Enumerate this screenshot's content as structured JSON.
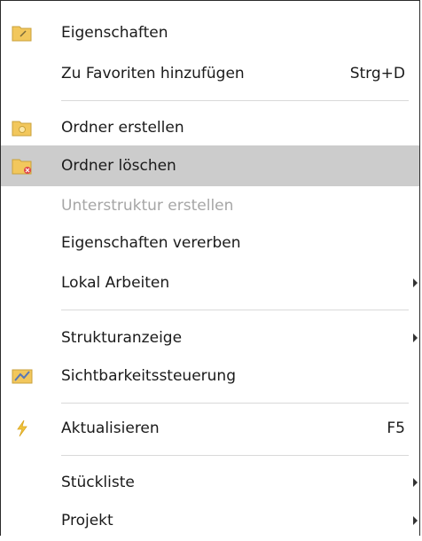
{
  "menu": {
    "items": [
      {
        "label": "Eigenschaften",
        "icon": "folder-edit-icon"
      },
      {
        "label": "Zu Favoriten hinzufügen",
        "shortcut": "Strg+D"
      },
      {
        "label": "Ordner erstellen",
        "icon": "folder-new-icon"
      },
      {
        "label": "Ordner löschen",
        "icon": "folder-delete-icon",
        "state": "highlighted"
      },
      {
        "label": "Unterstruktur erstellen",
        "state": "disabled"
      },
      {
        "label": "Eigenschaften vererben"
      },
      {
        "label": "Lokal Arbeiten",
        "submenu": true
      },
      {
        "label": "Strukturanzeige",
        "submenu": true
      },
      {
        "label": "Sichtbarkeitssteuerung",
        "icon": "visibility-control-icon"
      },
      {
        "label": "Aktualisieren",
        "icon": "lightning-icon",
        "shortcut": "F5"
      },
      {
        "label": "Stückliste",
        "submenu": true
      },
      {
        "label": "Projekt",
        "submenu": true
      }
    ]
  },
  "colors": {
    "highlight": "#cccccc",
    "disabled_text": "#a6a6a6",
    "folder": "#f2c75c",
    "lightning": "#f0c43c"
  }
}
